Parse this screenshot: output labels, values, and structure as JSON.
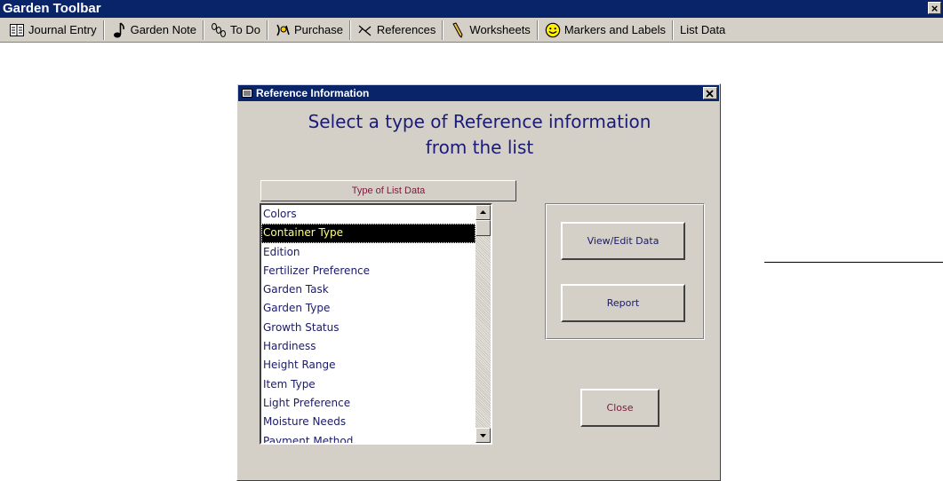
{
  "toolbar": {
    "title": "Garden Toolbar",
    "buttons": [
      {
        "label": "Journal Entry",
        "icon": "journal-icon"
      },
      {
        "label": "Garden Note",
        "icon": "music-note-icon"
      },
      {
        "label": "To Do",
        "icon": "footprints-icon"
      },
      {
        "label": "Purchase",
        "icon": "coins-icon"
      },
      {
        "label": "References",
        "icon": "pointer-icon"
      },
      {
        "label": "Worksheets",
        "icon": "pencil-icon"
      },
      {
        "label": "Markers and Labels",
        "icon": "smiley-icon"
      },
      {
        "label": "List Data",
        "icon": ""
      }
    ]
  },
  "dialog": {
    "title": "Reference Information",
    "heading_line1": "Select a type of Reference information",
    "heading_line2": "from the list",
    "column_header": "Type of List Data",
    "list_items": [
      "Colors",
      "Container Type",
      "Edition",
      "Fertilizer Preference",
      "Garden Task",
      "Garden Type",
      "Growth Status",
      "Hardiness",
      "Height Range",
      "Item Type",
      "Light Preference",
      "Moisture Needs",
      "Payment Method"
    ],
    "selected_item": "Container Type",
    "buttons": {
      "view_edit": "View/Edit Data",
      "report": "Report",
      "close": "Close"
    }
  },
  "colors": {
    "titlebar": "#0a246a",
    "face": "#d4d0c8",
    "list_text": "#1a1a6a",
    "selection": "#000000",
    "selection_text": "#ffff80"
  }
}
